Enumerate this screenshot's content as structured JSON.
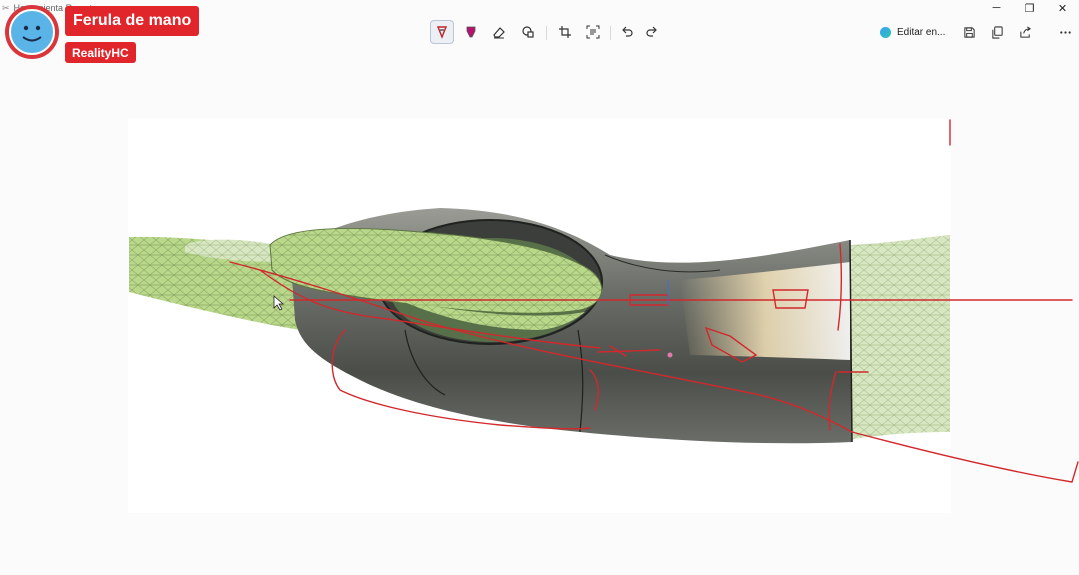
{
  "window": {
    "title": "Herramienta Recortes",
    "controls": {
      "minimize": "─",
      "maximize": "❐",
      "close": "✕"
    }
  },
  "toolbar": {
    "tools": [
      {
        "name": "ballpoint-pen",
        "icon": "pen-icon",
        "active": true
      },
      {
        "name": "highlighter",
        "icon": "highlighter-icon",
        "active": false
      },
      {
        "name": "eraser",
        "icon": "eraser-icon",
        "active": false
      },
      {
        "name": "shapes",
        "icon": "shapes-icon",
        "active": false
      },
      {
        "name": "crop",
        "icon": "crop-icon",
        "active": false
      },
      {
        "name": "text-actions",
        "icon": "text-actions-icon",
        "active": false
      },
      {
        "name": "undo",
        "icon": "undo-icon",
        "active": false
      },
      {
        "name": "redo",
        "icon": "redo-icon",
        "active": false
      }
    ],
    "edit_label": "Editar en...",
    "right_tools": [
      "save-icon",
      "copy-icon",
      "share-icon",
      "more-icon"
    ]
  },
  "overlay": {
    "title": "Ferula de mano",
    "channel": "RealityHC",
    "accent": "#e0262b"
  },
  "colors": {
    "annotation": "#d2282c",
    "mesh_green": "#b9d88a",
    "splint_dark": "#5c5f5a"
  }
}
